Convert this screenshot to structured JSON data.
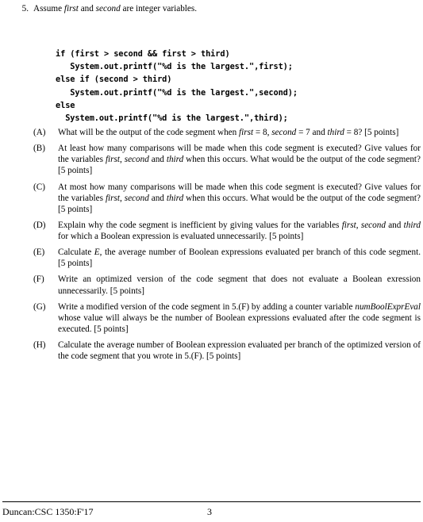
{
  "problem": {
    "number": "5.",
    "text_parts": [
      {
        "t": "Assume ",
        "style": "roman"
      },
      {
        "t": "first",
        "style": "italic"
      },
      {
        "t": " and ",
        "style": "roman"
      },
      {
        "t": "second",
        "style": "italic"
      },
      {
        "t": " are integer variables.",
        "style": "roman"
      }
    ],
    "plain": "5. Assume first and second are integer variables."
  },
  "code": {
    "language": "java",
    "lines": [
      "if (first > second && first > third)",
      "   System.out.printf(\"%d is the largest.\",first);",
      "else if (second > third)",
      "   System.out.printf(\"%d is the largest.\",second);",
      "else",
      "  System.out.printf(\"%d is the largest.\",third);"
    ]
  },
  "items": [
    {
      "label": "(A)",
      "parts": [
        {
          "t": "What will be the output of the code segment when ",
          "style": "roman"
        },
        {
          "t": "first",
          "style": "italic"
        },
        {
          "t": " = 8, ",
          "style": "roman"
        },
        {
          "t": "second",
          "style": "italic"
        },
        {
          "t": " = 7 and ",
          "style": "roman"
        },
        {
          "t": "third",
          "style": "italic"
        },
        {
          "t": " = 8? [5 points]",
          "style": "roman"
        }
      ]
    },
    {
      "label": "(B)",
      "parts": [
        {
          "t": "At least how many comparisons will be made when this code segment is executed? Give values for the variables ",
          "style": "roman"
        },
        {
          "t": "first",
          "style": "italic"
        },
        {
          "t": ", ",
          "style": "roman"
        },
        {
          "t": "second",
          "style": "italic"
        },
        {
          "t": " and ",
          "style": "roman"
        },
        {
          "t": "third",
          "style": "italic"
        },
        {
          "t": " when this occurs.  What would be the output of the code segment? [5 points]",
          "style": "roman"
        }
      ]
    },
    {
      "label": "(C)",
      "parts": [
        {
          "t": "At most how many comparisons will be made when this code segment is executed? Give values for the variables ",
          "style": "roman"
        },
        {
          "t": "first",
          "style": "italic"
        },
        {
          "t": ", ",
          "style": "roman"
        },
        {
          "t": "second",
          "style": "italic"
        },
        {
          "t": " and ",
          "style": "roman"
        },
        {
          "t": "third",
          "style": "italic"
        },
        {
          "t": " when this occurs.  What would be the output of the code segment? [5 points]",
          "style": "roman"
        }
      ]
    },
    {
      "label": "(D)",
      "parts": [
        {
          "t": "Explain why the code segment is inefficient by giving values for the variables ",
          "style": "roman"
        },
        {
          "t": "first",
          "style": "italic"
        },
        {
          "t": ", ",
          "style": "roman"
        },
        {
          "t": "second",
          "style": "italic"
        },
        {
          "t": " and ",
          "style": "roman"
        },
        {
          "t": "third",
          "style": "italic"
        },
        {
          "t": " for which a Boolean expression is evaluated unnecessarily. [5 points]",
          "style": "roman"
        }
      ]
    },
    {
      "label": "(E)",
      "parts": [
        {
          "t": "Calculate ",
          "style": "roman"
        },
        {
          "t": "E",
          "style": "italic"
        },
        {
          "t": ", the average number of Boolean expressions evaluated per branch of this code segment. [5 points]",
          "style": "roman"
        }
      ]
    },
    {
      "label": "(F)",
      "parts": [
        {
          "t": "Write an optimized version of the code segment that does not evaluate a Boolean exression unnecessarily. [5 points]",
          "style": "roman"
        }
      ]
    },
    {
      "label": "(G)",
      "parts": [
        {
          "t": "Write a modified version of the code segment in 5.(F) by adding a counter variable ",
          "style": "roman"
        },
        {
          "t": "numBoolExprEval",
          "style": "italic"
        },
        {
          "t": " whose value will always be the number of Boolean expressions evaluated after the code segment is executed. [5 points]",
          "style": "roman"
        }
      ]
    },
    {
      "label": "(H)",
      "parts": [
        {
          "t": "Calculate the average number of Boolean expression evaluated per branch of the optimized version of the code segment that you wrote in 5.(F). [5 points]",
          "style": "roman"
        }
      ]
    }
  ],
  "footer": {
    "left": "Duncan:CSC 1350:F'17",
    "page_number": "3"
  },
  "colors": {
    "text": "#000000",
    "background": "#ffffff",
    "rule": "#000000"
  }
}
